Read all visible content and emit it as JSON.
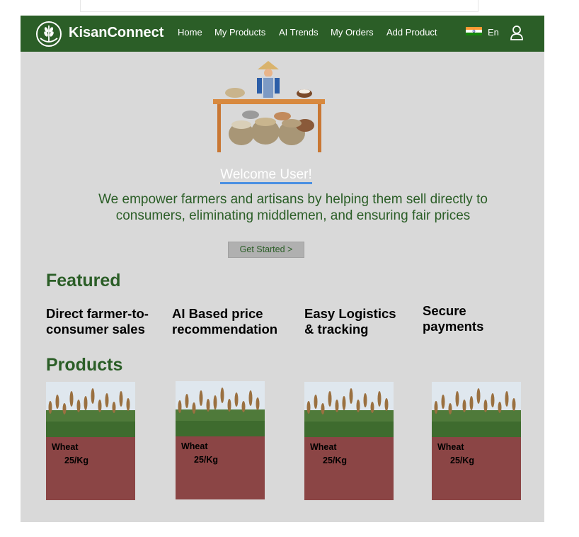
{
  "nav": {
    "brand": "KisanConnect",
    "links": [
      "Home",
      "My Products",
      "AI Trends",
      "My Orders",
      "Add Product"
    ],
    "language": "En"
  },
  "hero": {
    "welcome": "Welcome User!",
    "tagline_line1": "We empower farmers and artisans by helping them sell directly to",
    "tagline_line2": "consumers, eliminating middlemen, and ensuring fair prices",
    "cta": "Get Started >"
  },
  "featured": {
    "title": "Featured",
    "items": [
      {
        "line1": "Direct farmer-to-",
        "line2": "consumer sales"
      },
      {
        "line1": "AI Based price",
        "line2": "recommendation"
      },
      {
        "line1": "Easy Logistics",
        "line2": "& tracking"
      },
      {
        "line1": "Secure",
        "line2": "payments"
      }
    ]
  },
  "products": {
    "title": "Products",
    "items": [
      {
        "name": "Wheat",
        "price": "25/Kg"
      },
      {
        "name": "Wheat",
        "price": "25/Kg"
      },
      {
        "name": "Wheat",
        "price": "25/Kg"
      },
      {
        "name": "Wheat",
        "price": "25/Kg"
      }
    ]
  },
  "colors": {
    "nav": "#2b5e27",
    "accent": "#2b5e27",
    "card": "#8b4545",
    "frame": "#d9d9d9"
  }
}
